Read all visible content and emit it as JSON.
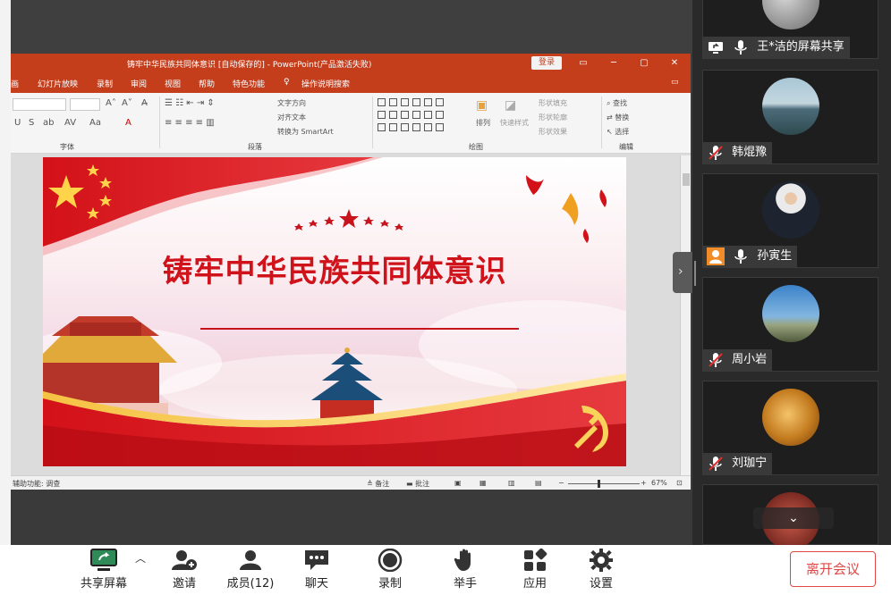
{
  "ppt": {
    "window_title": "铸牢中华民族共同体意识 [自动保存的] - PowerPoint(产品激活失败)",
    "login_label": "登录",
    "menu": [
      "画",
      "幻灯片放映",
      "录制",
      "审阅",
      "视图",
      "帮助",
      "特色功能"
    ],
    "tell_me": "操作说明搜索",
    "ribbon": {
      "font_group": "字体",
      "paragraph_group": "段落",
      "drawing_group": "绘图",
      "editing_group": "编辑",
      "text_direction": "文字方向",
      "align_text": "对齐文本",
      "smartart": "转换为 SmartArt",
      "arrange": "排列",
      "quick_styles": "快速样式",
      "shape_fill": "形状填充",
      "shape_outline": "形状轮廓",
      "shape_effects": "形状效果",
      "find": "查找",
      "replace": "替换",
      "select": "选择"
    },
    "status": {
      "accessibility": "辅助功能: 调查",
      "notes": "备注",
      "comments": "批注",
      "zoom": "67%"
    },
    "slide": {
      "title": "铸牢中华民族共同体意识"
    }
  },
  "participants": [
    {
      "name": "王*洁的屏幕共享",
      "status": "sharing"
    },
    {
      "name": "韩焜豫",
      "status": "muted"
    },
    {
      "name": "孙寅生",
      "status": "speaking"
    },
    {
      "name": "周小岩",
      "status": "muted"
    },
    {
      "name": "刘珈宁",
      "status": "muted"
    }
  ],
  "toolbar": {
    "share_screen": "共享屏幕",
    "invite": "邀请",
    "members": "成员(12)",
    "chat": "聊天",
    "record": "录制",
    "raise_hand": "举手",
    "apps": "应用",
    "settings": "设置",
    "leave": "离开会议"
  },
  "colors": {
    "ppt_accent": "#c43e1c",
    "slide_red": "#d0121b",
    "leave_red": "#e04848",
    "share_green": "#2e8b57"
  }
}
